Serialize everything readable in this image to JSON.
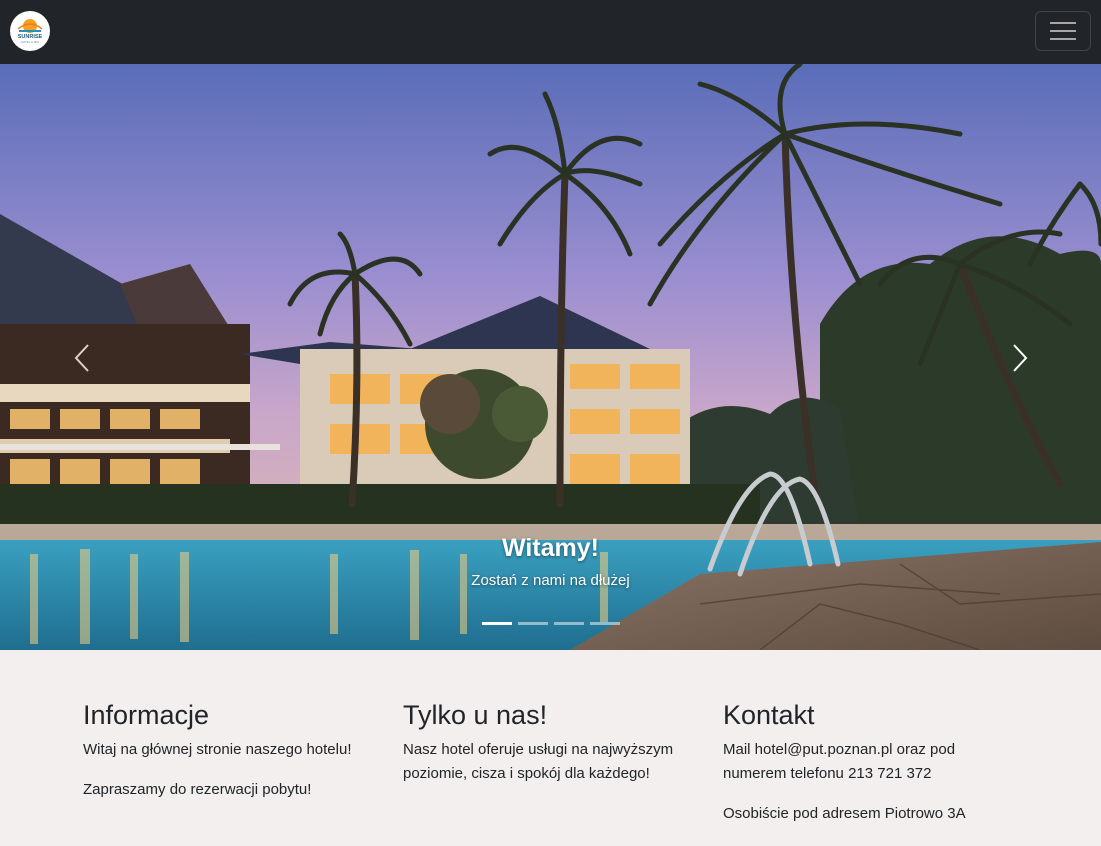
{
  "navbar": {
    "logo_text": "SUNRISE",
    "logo_subtext": "HOTEL & SPA",
    "colors": {
      "background": "#212529"
    }
  },
  "carousel": {
    "caption_title": "Witamy!",
    "caption_text": "Zostań z nami na dłużej",
    "slide_count": 4,
    "active_slide": 1,
    "prev_icon": "chevron-left-icon",
    "next_icon": "chevron-right-icon"
  },
  "sections": [
    {
      "heading": "Informacje",
      "paragraphs": [
        "Witaj na głównej stronie naszego hotelu!",
        "Zapraszamy do rezerwacji pobytu!"
      ]
    },
    {
      "heading": "Tylko u nas!",
      "paragraphs": [
        "Nasz hotel oferuje usługi na najwyższym poziomie, cisza i spokój dla każdego!"
      ]
    },
    {
      "heading": "Kontakt",
      "paragraphs": [
        "Mail hotel@put.poznan.pl oraz pod numerem telefonu 213 721 372",
        "Osobiście pod adresem Piotrowo 3A"
      ]
    }
  ]
}
